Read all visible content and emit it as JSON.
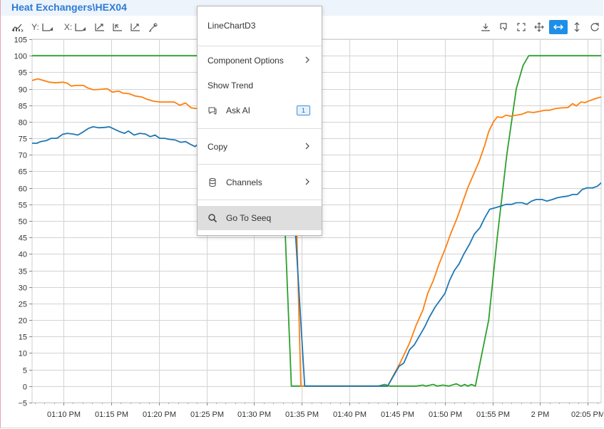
{
  "panel": {
    "title": "Heat Exchangers\\HEX04"
  },
  "toolbar": {
    "y_label": "Y:",
    "x_label": "X:",
    "left_icons": [
      "chart-options-icon",
      "y-axis-icon",
      "x-axis-icon",
      "zoom-box-icon",
      "zoom-x-icon",
      "auto-scale-icon",
      "brush-icon"
    ],
    "right_icons": [
      "download-icon",
      "copy-image-icon",
      "fullscreen-icon",
      "pan-icon",
      "pan-horizontal-icon",
      "pan-vertical-icon",
      "reset-icon"
    ]
  },
  "context_menu": {
    "title": "LineChartD3",
    "items": [
      {
        "label": "Component Options",
        "has_submenu": true
      },
      {
        "label": "Show Trend"
      },
      {
        "label": "Ask AI",
        "badge": "1",
        "icon": "chat-icon"
      },
      {
        "label": "Copy",
        "has_submenu": true
      },
      {
        "label": "Channels",
        "has_submenu": true,
        "icon": "database-icon"
      },
      {
        "label": "Go To Seeq",
        "icon": "search-icon",
        "highlighted": true
      }
    ]
  },
  "chart_data": {
    "type": "line",
    "x_ticks": [
      "01:10 PM",
      "01:15 PM",
      "01:20 PM",
      "01:25 PM",
      "01:30 PM",
      "01:35 PM",
      "01:40 PM",
      "01:45 PM",
      "01:50 PM",
      "01:55 PM",
      "2 PM",
      "02:05 PM"
    ],
    "y_ticks": [
      -5,
      0,
      5,
      10,
      15,
      20,
      25,
      30,
      35,
      40,
      45,
      50,
      55,
      60,
      65,
      70,
      75,
      80,
      85,
      90,
      95,
      100,
      105
    ],
    "xlim_minutes_after_1pm": [
      6.7,
      66.4
    ],
    "ylim": [
      -5,
      105
    ],
    "grid": true,
    "series": [
      {
        "color": "#2ca02c",
        "points": [
          [
            6.7,
            100
          ],
          [
            32.5,
            100
          ],
          [
            33.9,
            0
          ],
          [
            38.6,
            0
          ],
          [
            40.3,
            0
          ],
          [
            41,
            0
          ],
          [
            43,
            0
          ],
          [
            43.7,
            0.5
          ],
          [
            44.2,
            0
          ],
          [
            47,
            0
          ],
          [
            47.7,
            0.3
          ],
          [
            48,
            0
          ],
          [
            48.8,
            0.5
          ],
          [
            49.2,
            0
          ],
          [
            49.8,
            0.3
          ],
          [
            50.4,
            0
          ],
          [
            51.2,
            0.7
          ],
          [
            51.7,
            0
          ],
          [
            52.1,
            0.5
          ],
          [
            52.4,
            0
          ],
          [
            52.8,
            0.5
          ],
          [
            53.2,
            0
          ],
          [
            54.6,
            20
          ],
          [
            55.5,
            45
          ],
          [
            56.5,
            70
          ],
          [
            57.5,
            90
          ],
          [
            58.2,
            97
          ],
          [
            58.8,
            100
          ],
          [
            61,
            100
          ],
          [
            66.4,
            100
          ]
        ]
      },
      {
        "color": "#ff7f0e",
        "points": [
          [
            6.7,
            92.5
          ],
          [
            7.3,
            93
          ],
          [
            8.5,
            92
          ],
          [
            9.2,
            91.8
          ],
          [
            9.9,
            92
          ],
          [
            10.4,
            91.7
          ],
          [
            10.8,
            90.8
          ],
          [
            11.3,
            91
          ],
          [
            12.1,
            91
          ],
          [
            12.5,
            90.3
          ],
          [
            13.1,
            89.7
          ],
          [
            13.7,
            89.8
          ],
          [
            14.6,
            90
          ],
          [
            15.1,
            89
          ],
          [
            15.8,
            89.3
          ],
          [
            16.2,
            88.7
          ],
          [
            16.9,
            88.5
          ],
          [
            17.5,
            87.8
          ],
          [
            18.2,
            87.5
          ],
          [
            18.8,
            86.8
          ],
          [
            19.5,
            86.2
          ],
          [
            20.2,
            86
          ],
          [
            20.8,
            86
          ],
          [
            21.6,
            86
          ],
          [
            22.2,
            85
          ],
          [
            22.8,
            85.7
          ],
          [
            23.4,
            84.2
          ],
          [
            24,
            84
          ],
          [
            24.6,
            85
          ],
          [
            25.2,
            84.5
          ],
          [
            25.6,
            85
          ],
          [
            26.1,
            86.5
          ],
          [
            27,
            87
          ],
          [
            27.5,
            87.5
          ],
          [
            28.8,
            87.3
          ],
          [
            29.6,
            87
          ],
          [
            32.5,
            86.8
          ],
          [
            33.3,
            86
          ],
          [
            34.1,
            86
          ],
          [
            34.9,
            0
          ],
          [
            36,
            0
          ],
          [
            44,
            0
          ],
          [
            45.3,
            7
          ],
          [
            46.3,
            13
          ],
          [
            47,
            18.5
          ],
          [
            47.7,
            23
          ],
          [
            48.2,
            28
          ],
          [
            48.8,
            32
          ],
          [
            49.4,
            37
          ],
          [
            50.1,
            42
          ],
          [
            50.6,
            46
          ],
          [
            51.3,
            51
          ],
          [
            51.8,
            55
          ],
          [
            52.4,
            60
          ],
          [
            53,
            64
          ],
          [
            53.6,
            68
          ],
          [
            54.2,
            73
          ],
          [
            54.6,
            77
          ],
          [
            55.1,
            80
          ],
          [
            55.5,
            81.5
          ],
          [
            56,
            81.3
          ],
          [
            56.4,
            82
          ],
          [
            56.9,
            81.7
          ],
          [
            57.5,
            82
          ],
          [
            58.1,
            82.3
          ],
          [
            58.7,
            83
          ],
          [
            59.3,
            82.8
          ],
          [
            60,
            83.2
          ],
          [
            60.5,
            83.5
          ],
          [
            61,
            83.5
          ],
          [
            61.6,
            84
          ],
          [
            62.2,
            84.2
          ],
          [
            62.9,
            84.3
          ],
          [
            63.4,
            85.5
          ],
          [
            63.8,
            84.8
          ],
          [
            64.3,
            86
          ],
          [
            64.7,
            85.8
          ],
          [
            65.1,
            86.3
          ],
          [
            65.6,
            86.8
          ],
          [
            66,
            87.2
          ],
          [
            66.4,
            87.5
          ]
        ]
      },
      {
        "color": "#1f77b4",
        "points": [
          [
            6.7,
            73.5
          ],
          [
            7.2,
            73.5
          ],
          [
            7.6,
            74
          ],
          [
            8.2,
            74.3
          ],
          [
            8.7,
            75
          ],
          [
            9.3,
            75
          ],
          [
            9.9,
            76.2
          ],
          [
            10.4,
            76.5
          ],
          [
            11,
            76.3
          ],
          [
            11.5,
            76
          ],
          [
            12.1,
            77
          ],
          [
            12.6,
            78
          ],
          [
            13.1,
            78.5
          ],
          [
            13.7,
            78.2
          ],
          [
            14.3,
            78.3
          ],
          [
            14.8,
            78.5
          ],
          [
            15.3,
            77.8
          ],
          [
            15.9,
            77
          ],
          [
            16.4,
            76.5
          ],
          [
            16.8,
            77.2
          ],
          [
            17.4,
            76
          ],
          [
            18,
            76.5
          ],
          [
            18.6,
            76.3
          ],
          [
            19.1,
            75.5
          ],
          [
            19.6,
            76
          ],
          [
            20.1,
            75
          ],
          [
            20.6,
            75
          ],
          [
            21.1,
            74.7
          ],
          [
            21.7,
            74.5
          ],
          [
            22.3,
            73.8
          ],
          [
            22.8,
            74
          ],
          [
            23.3,
            73.2
          ],
          [
            23.8,
            72.5
          ],
          [
            24.4,
            74
          ],
          [
            24.9,
            72.5
          ],
          [
            25.4,
            72.5
          ],
          [
            26,
            72.2
          ],
          [
            32.5,
            72
          ],
          [
            33.8,
            72
          ],
          [
            35.3,
            0
          ],
          [
            36.5,
            0
          ],
          [
            44,
            0
          ],
          [
            45.2,
            6
          ],
          [
            45.7,
            7
          ],
          [
            46.3,
            11
          ],
          [
            46.8,
            12.5
          ],
          [
            47.3,
            15
          ],
          [
            47.9,
            18
          ],
          [
            48.4,
            21
          ],
          [
            49,
            24
          ],
          [
            49.5,
            26
          ],
          [
            50,
            28
          ],
          [
            50.5,
            32
          ],
          [
            51,
            35
          ],
          [
            51.5,
            37
          ],
          [
            52,
            40
          ],
          [
            52.6,
            43
          ],
          [
            53.1,
            46
          ],
          [
            53.7,
            48
          ],
          [
            54.2,
            51
          ],
          [
            54.7,
            53.5
          ],
          [
            55.3,
            54
          ],
          [
            55.9,
            54.5
          ],
          [
            56.4,
            55
          ],
          [
            57,
            55
          ],
          [
            57.5,
            55.5
          ],
          [
            58.1,
            55.5
          ],
          [
            58.6,
            55
          ],
          [
            59.1,
            56
          ],
          [
            59.6,
            56.5
          ],
          [
            60.2,
            56.5
          ],
          [
            60.7,
            56
          ],
          [
            61.3,
            56.5
          ],
          [
            61.8,
            57
          ],
          [
            62.3,
            57.3
          ],
          [
            62.9,
            57.5
          ],
          [
            63.4,
            58
          ],
          [
            63.9,
            58
          ],
          [
            64.4,
            59.5
          ],
          [
            64.9,
            60
          ],
          [
            65.5,
            60
          ],
          [
            66,
            60.5
          ],
          [
            66.4,
            61.5
          ],
          [
            66.9,
            62.5
          ],
          [
            67.3,
            62
          ],
          [
            67.7,
            61.5
          ]
        ]
      }
    ]
  }
}
